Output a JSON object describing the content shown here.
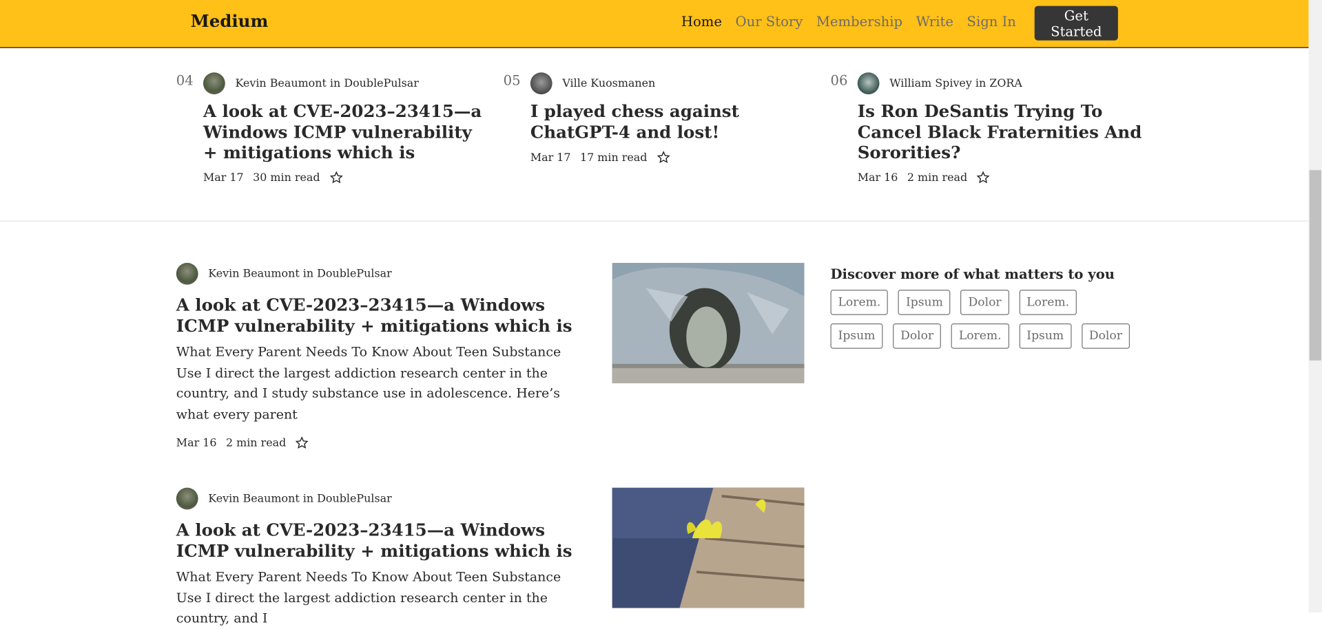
{
  "header": {
    "logo": "Medium",
    "nav": [
      "Home",
      "Our Story",
      "Membership",
      "Write",
      "Sign In"
    ],
    "cta": "Get Started"
  },
  "trending": [
    {
      "num": "04",
      "author": "Kevin Beaumont in DoublePulsar",
      "title": "A look at CVE-2023–23415—a Windows ICMP vulnerability + mitigations which is",
      "date": "Mar 17",
      "read": "30 min read"
    },
    {
      "num": "05",
      "author": "Ville Kuosmanen",
      "title": "I played chess against ChatGPT-4 and lost!",
      "date": "Mar 17",
      "read": "17 min read"
    },
    {
      "num": "06",
      "author": "William Spivey in ZORA",
      "title": "Is Ron DeSantis Trying To Cancel Black Fraternities And Sororities?",
      "date": "Mar 16",
      "read": "2 min read"
    }
  ],
  "articles": [
    {
      "author": "Kevin Beaumont in DoublePulsar",
      "title": "A look at CVE-2023–23415—a Windows ICMP vulnerability + mitigations which is",
      "excerpt": "What Every Parent Needs To Know About Teen Substance Use I direct the largest addiction research center in the country, and I study substance use in adolescence. Here’s what every parent",
      "date": "Mar 16",
      "read": "2 min read"
    },
    {
      "author": "Kevin Beaumont in DoublePulsar",
      "title": "A look at CVE-2023–23415—a Windows ICMP vulnerability + mitigations which is",
      "excerpt": "What Every Parent Needs To Know About Teen Substance Use I direct the largest addiction research center in the country, and I"
    }
  ],
  "discover": {
    "heading": "Discover more of what matters to you",
    "tags": [
      "Lorem.",
      "Ipsum",
      "Dolor",
      "Lorem.",
      "Ipsum",
      "Dolor",
      "Lorem.",
      "Ipsum",
      "Dolor"
    ]
  },
  "icons": {
    "bookmark": "star-icon"
  }
}
